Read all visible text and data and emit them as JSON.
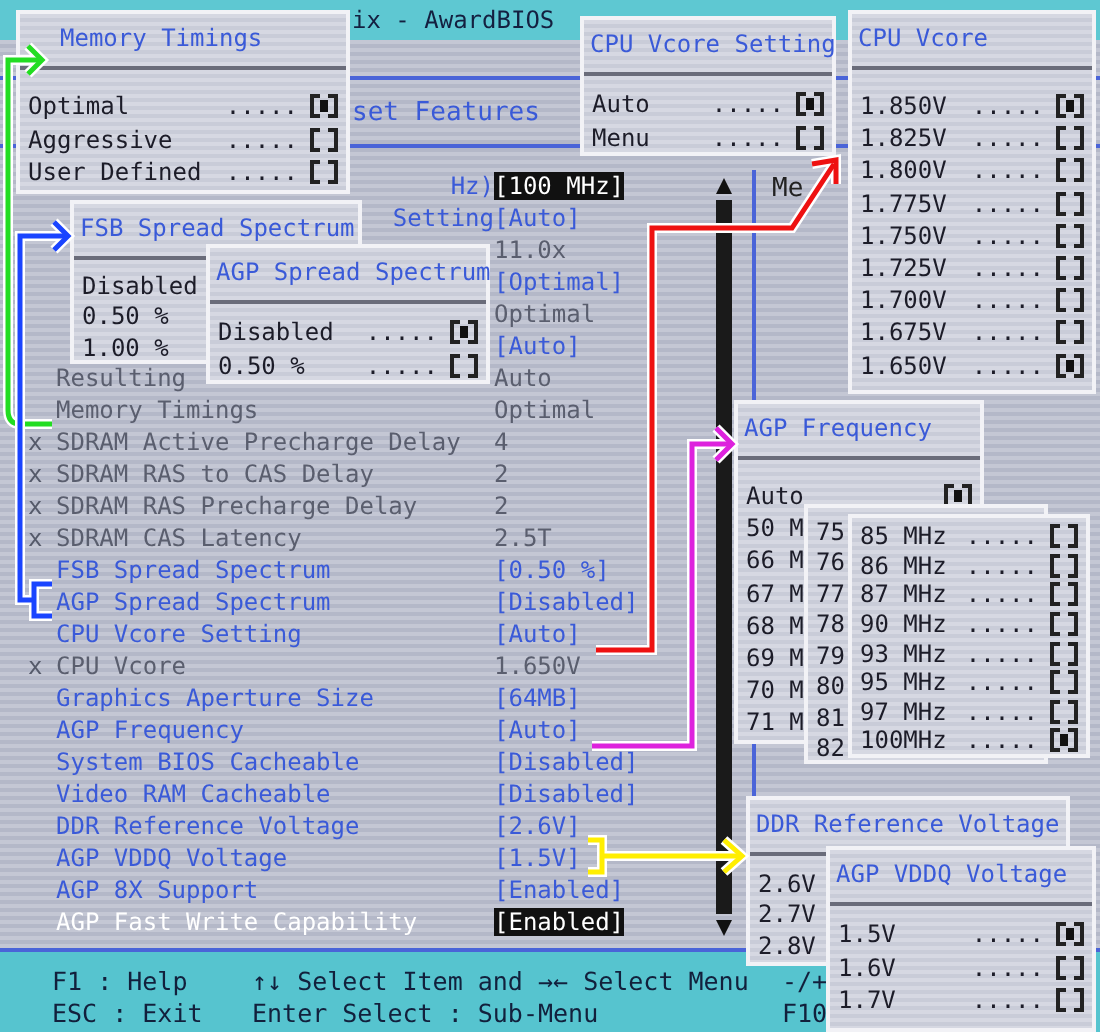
{
  "title_bar": {
    "title": "ix - AwardBIOS"
  },
  "subtitle": "set Features",
  "settings": [
    {
      "label": "Hz)",
      "truncated": true,
      "value": "[100 MHz]",
      "disabled": false,
      "selected": false,
      "highlighted": true
    },
    {
      "label": "Setting",
      "truncated": true,
      "value": "[Auto]",
      "disabled": false,
      "selected": false,
      "highlighted": false
    },
    {
      "value": "11.0x",
      "disabled": true,
      "selected": false,
      "highlighted": false
    },
    {
      "value": "[Optimal]",
      "disabled": false,
      "selected": false,
      "highlighted": false
    },
    {
      "value": "Optimal",
      "disabled": true,
      "selected": false,
      "highlighted": false
    },
    {
      "value": "[Auto]",
      "disabled": false,
      "selected": false,
      "highlighted": false
    },
    {
      "label": "Resulting",
      "truncated": false,
      "value": "Auto",
      "disabled": true,
      "selected": false,
      "highlighted": false
    },
    {
      "label": "Memory Timings",
      "truncated": false,
      "value": "Optimal",
      "disabled": true,
      "selected": false,
      "highlighted": false
    },
    {
      "prefix": "x",
      "label": "SDRAM Active Precharge Delay",
      "truncated": false,
      "value": "4",
      "disabled": true,
      "selected": false,
      "highlighted": false
    },
    {
      "prefix": "x",
      "label": "SDRAM RAS to CAS Delay",
      "truncated": false,
      "value": "2",
      "disabled": true,
      "selected": false,
      "highlighted": false
    },
    {
      "prefix": "x",
      "label": "SDRAM RAS Precharge Delay",
      "truncated": false,
      "value": "2",
      "disabled": true,
      "selected": false,
      "highlighted": false
    },
    {
      "prefix": "x",
      "label": "SDRAM CAS Latency",
      "truncated": false,
      "value": "2.5T",
      "disabled": true,
      "selected": false,
      "highlighted": false
    },
    {
      "label": "FSB Spread Spectrum",
      "truncated": false,
      "value": "[0.50 %]",
      "disabled": false,
      "selected": false,
      "highlighted": false
    },
    {
      "label": "AGP Spread Spectrum",
      "truncated": false,
      "value": "[Disabled]",
      "disabled": false,
      "selected": false,
      "highlighted": false
    },
    {
      "label": "CPU Vcore Setting",
      "truncated": false,
      "value": "[Auto]",
      "disabled": false,
      "selected": false,
      "highlighted": false
    },
    {
      "prefix": "x",
      "label": "CPU Vcore",
      "truncated": false,
      "value": "1.650V",
      "disabled": true,
      "selected": false,
      "highlighted": false
    },
    {
      "label": "Graphics Aperture Size",
      "truncated": false,
      "value": "[64MB]",
      "disabled": false,
      "selected": false,
      "highlighted": false
    },
    {
      "label": "AGP Frequency",
      "truncated": false,
      "value": "[Auto]",
      "disabled": false,
      "selected": false,
      "highlighted": false
    },
    {
      "label": "System BIOS Cacheable",
      "truncated": false,
      "value": "[Disabled]",
      "disabled": false,
      "selected": false,
      "highlighted": false
    },
    {
      "label": "Video RAM Cacheable",
      "truncated": false,
      "value": "[Disabled]",
      "disabled": false,
      "selected": false,
      "highlighted": false
    },
    {
      "label": "DDR Reference Voltage",
      "truncated": false,
      "value": "[2.6V]",
      "disabled": false,
      "selected": false,
      "highlighted": false
    },
    {
      "label": "AGP VDDQ Voltage",
      "truncated": false,
      "value": "[1.5V]",
      "disabled": false,
      "selected": false,
      "highlighted": false
    },
    {
      "label": "AGP 8X Support",
      "truncated": false,
      "value": "[Enabled]",
      "disabled": false,
      "selected": false,
      "highlighted": false
    },
    {
      "label": "AGP Fast Write Capability",
      "truncated": false,
      "value": "[Enabled]",
      "disabled": false,
      "selected": true,
      "highlighted": true
    }
  ],
  "help_panel": {
    "text": "Me"
  },
  "popups": [
    {
      "title": "Memory Timings",
      "options": [
        {
          "label": "Optimal",
          "leader": ".....",
          "selected": true
        },
        {
          "label": "Aggressive",
          "leader": ".....",
          "selected": false
        },
        {
          "label": "User Defined",
          "leader": ".....",
          "selected": false
        }
      ]
    },
    {
      "title": "FSB Spread Spectrum",
      "options": [
        {
          "label": "Disabled"
        },
        {
          "label": "0.50 %"
        },
        {
          "label": "1.00 %"
        }
      ]
    },
    {
      "title": "AGP Spread Spectrum",
      "options": [
        {
          "label": "Disabled",
          "leader": ".....",
          "selected": true
        },
        {
          "label": "0.50 %",
          "leader": ".....",
          "selected": false
        }
      ]
    },
    {
      "title": "CPU Vcore Setting",
      "options": [
        {
          "label": "Auto",
          "leader": ".....",
          "selected": true
        },
        {
          "label": "Menu",
          "leader": ".....",
          "selected": false
        }
      ]
    },
    {
      "title": "CPU Vcore",
      "options": [
        {
          "label": "1.850V",
          "leader": ".....",
          "selected": true
        },
        {
          "label": "1.825V",
          "leader": ".....",
          "selected": false
        },
        {
          "label": "1.800V",
          "leader": ".....",
          "selected": false
        },
        {
          "label": "1.775V",
          "leader": ".....",
          "selected": false
        },
        {
          "label": "1.750V",
          "leader": ".....",
          "selected": false
        },
        {
          "label": "1.725V",
          "leader": ".....",
          "selected": false
        },
        {
          "label": "1.700V",
          "leader": ".....",
          "selected": false
        },
        {
          "label": "1.675V",
          "leader": ".....",
          "selected": false
        },
        {
          "label": "1.650V",
          "leader": ".....",
          "selected": true
        }
      ]
    },
    {
      "title": "AGP Frequency",
      "options": [
        {
          "label": "Auto",
          "selected": true
        },
        {
          "label": "50 M"
        },
        {
          "label": "66 M"
        },
        {
          "label": "67 M"
        },
        {
          "label": "68 M"
        },
        {
          "label": "69 M"
        },
        {
          "label": "70 M"
        },
        {
          "label": "71 M"
        }
      ]
    },
    {
      "options": [
        {
          "label": "75"
        },
        {
          "label": "76"
        },
        {
          "label": "77"
        },
        {
          "label": "78"
        },
        {
          "label": "79"
        },
        {
          "label": "80"
        },
        {
          "label": "81"
        },
        {
          "label": "82"
        }
      ]
    },
    {
      "options": [
        {
          "label": "85 MHz",
          "leader": ".....",
          "selected": false
        },
        {
          "label": "86 MHz",
          "leader": ".....",
          "selected": false
        },
        {
          "label": "87 MHz",
          "leader": ".....",
          "selected": false
        },
        {
          "label": "90 MHz",
          "leader": ".....",
          "selected": false
        },
        {
          "label": "93 MHz",
          "leader": ".....",
          "selected": false
        },
        {
          "label": "95 MHz",
          "leader": ".....",
          "selected": false
        },
        {
          "label": "97 MHz",
          "leader": ".....",
          "selected": false
        },
        {
          "label": "100MHz",
          "leader": ".....",
          "selected": true
        }
      ]
    },
    {
      "title": "DDR Reference Voltage",
      "options": [
        {
          "label": "2.6V"
        },
        {
          "label": "2.7V"
        },
        {
          "label": "2.8V"
        }
      ]
    },
    {
      "title": "AGP VDDQ Voltage",
      "options": [
        {
          "label": "1.5V",
          "leader": ".....",
          "selected": true
        },
        {
          "label": "1.6V",
          "leader": ".....",
          "selected": false
        },
        {
          "label": "1.7V",
          "leader": ".....",
          "selected": false
        }
      ]
    }
  ],
  "footer": [
    {
      "key": "F1  : Help",
      "action": "↑↓ Select Item and →← Select Menu",
      "extra": "-/+"
    },
    {
      "key": "ESC : Exit",
      "action": "Enter Select : Sub-Menu",
      "extra": "F10"
    }
  ]
}
